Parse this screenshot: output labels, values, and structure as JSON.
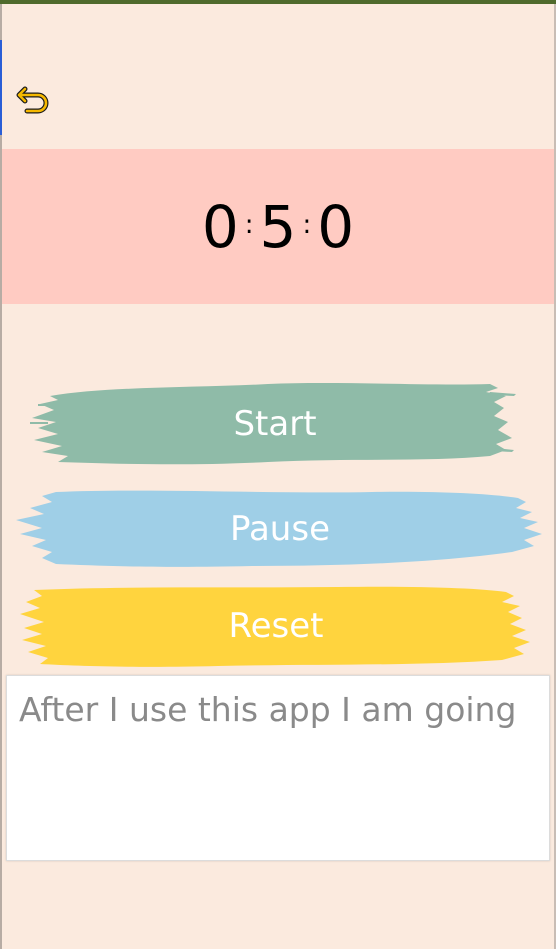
{
  "timer": {
    "hours": "0",
    "minutes": "5",
    "seconds": "0",
    "separator": ":"
  },
  "buttons": {
    "start": "Start",
    "pause": "Pause",
    "reset": "Reset"
  },
  "note": {
    "placeholder": "After I use this app I am going",
    "value": ""
  },
  "icons": {
    "back": "undo-arrow-icon"
  },
  "colors": {
    "background": "#fbeade",
    "timer_panel": "#ffcbc2",
    "start": "#8fbba8",
    "pause": "#9fcfe7",
    "reset": "#ffd43e",
    "back_icon": "#f5b800",
    "top_bar": "#4f6a2c"
  }
}
